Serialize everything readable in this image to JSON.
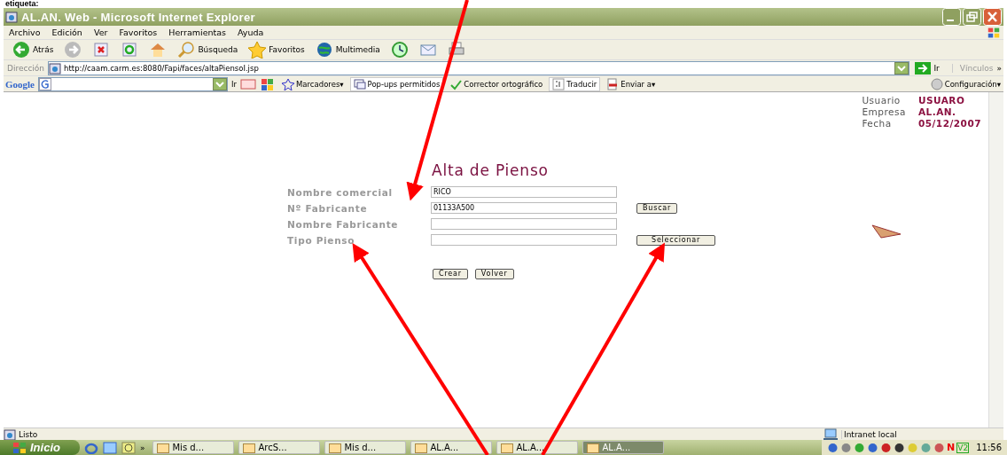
{
  "caption": "etiqueta:",
  "window": {
    "title": "AL.AN. Web - Microsoft Internet Explorer"
  },
  "menu": [
    "Archivo",
    "Edición",
    "Ver",
    "Favoritos",
    "Herramientas",
    "Ayuda"
  ],
  "toolbar": [
    {
      "kind": "back",
      "label": "Atrás"
    },
    {
      "kind": "forward"
    },
    {
      "kind": "stop"
    },
    {
      "kind": "refresh"
    },
    {
      "kind": "home"
    },
    {
      "kind": "search",
      "label": "Búsqueda"
    },
    {
      "kind": "favorites",
      "label": "Favoritos"
    },
    {
      "kind": "media",
      "label": "Multimedia"
    },
    {
      "kind": "history"
    },
    {
      "kind": "mail"
    },
    {
      "kind": "print"
    }
  ],
  "address": {
    "label": "Dirección",
    "value": "http://caam.carm.es:8080/Fapi/faces/altaPiensoI.jsp",
    "go": "Ir",
    "links": "Vínculos",
    "more": "»"
  },
  "google_bar": {
    "logo": "Google",
    "go": "Ir",
    "items": [
      "Marcadores▾",
      "Pop-ups permitidos",
      "Corrector ortográfico",
      "Traducir",
      "Enviar a▾",
      "Configuración▾"
    ]
  },
  "session": [
    {
      "label": "Usuario",
      "value": "USUARO"
    },
    {
      "label": "Empresa",
      "value": "AL.AN."
    },
    {
      "label": "Fecha",
      "value": "05/12/2007"
    }
  ],
  "form": {
    "title": "Alta de Pienso",
    "fields": [
      {
        "label": "Nombre comercial",
        "value": "RICO"
      },
      {
        "label": "Nº Fabricante",
        "value": "01133A500",
        "button": "Buscar"
      },
      {
        "label": "Nombre Fabricante"
      },
      {
        "label": "Tipo Pienso",
        "button": "Seleccionar"
      }
    ],
    "actions": [
      "Crear",
      "Volver"
    ]
  },
  "status_bar": {
    "text": "Listo",
    "zone": "Intranet local"
  },
  "taskbar": {
    "start": "Inicio",
    "more": "»",
    "tasks": [
      {
        "label": "Mis d...",
        "selected": false
      },
      {
        "label": "ArcS...",
        "selected": false
      },
      {
        "label": "Mis d...",
        "selected": false
      },
      {
        "label": "AL.A...",
        "selected": false
      },
      {
        "label": "AL.A...",
        "selected": false
      },
      {
        "label": "AL.A...",
        "selected": true
      }
    ],
    "tray_letters": [
      "N",
      "V2"
    ],
    "clock": "11:56"
  }
}
